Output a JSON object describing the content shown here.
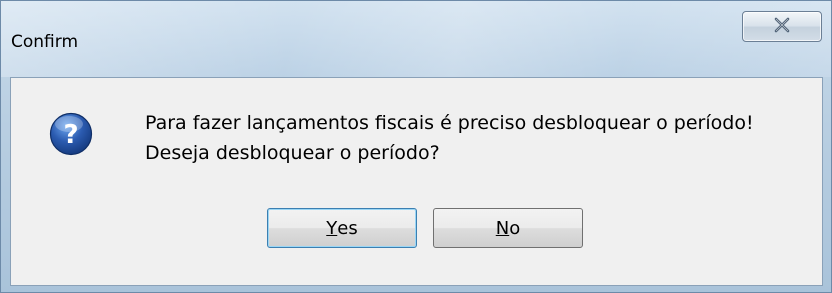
{
  "window": {
    "title": "Confirm",
    "close_icon": "close-icon"
  },
  "dialog": {
    "icon": "question-icon",
    "message_line1": "Para fazer lançamentos fiscais é preciso desbloquear o período!",
    "message_line2": "Deseja desbloquear o período?"
  },
  "buttons": {
    "yes": {
      "accel": "Y",
      "rest": "es"
    },
    "no": {
      "accel": "N",
      "rest": "o"
    }
  },
  "colors": {
    "accent": "#2b5bb0",
    "client_bg": "#f0f0f0"
  }
}
